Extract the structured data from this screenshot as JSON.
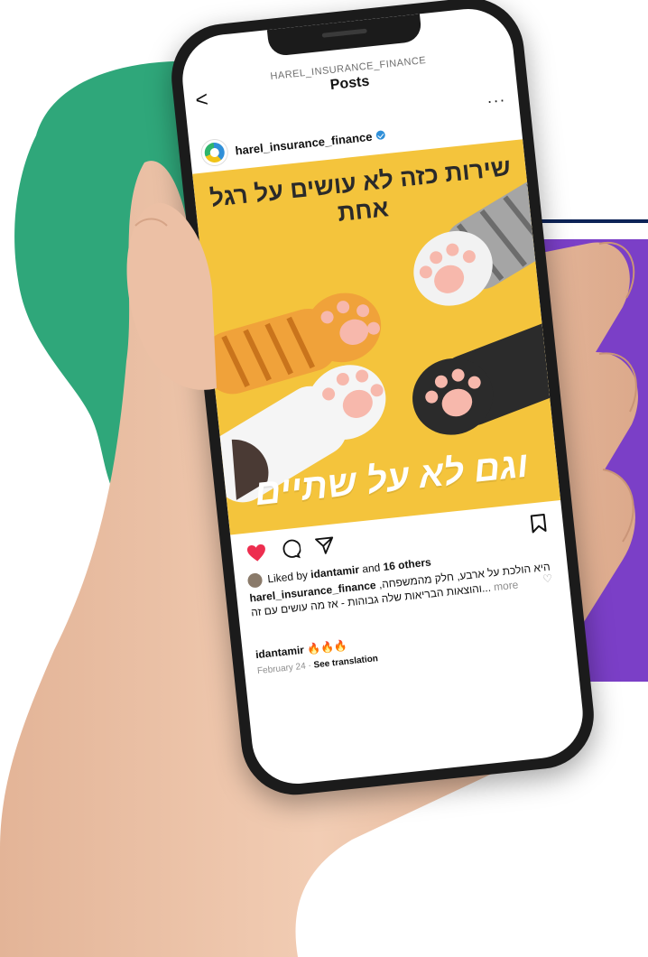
{
  "header": {
    "account": "HAREL_INSURANCE_FINANCE",
    "title": "Posts",
    "back_glyph": "<",
    "menu_glyph": "···"
  },
  "post": {
    "username": "harel_insurance_finance",
    "headline_line1": "שירות כזה לא עושים על רגל אחת",
    "headline_line2": "",
    "tagline": "וגם לא על שתיים"
  },
  "engagement": {
    "liked_prefix": "Liked by",
    "liked_user": "idantamir",
    "liked_mid": "and",
    "liked_count": "16 others"
  },
  "caption": {
    "username": "harel_insurance_finance",
    "text": "היא הולכת על ארבע, חלק מהמשפחה, והוצאות הבריאות שלה גבוהות - אז מה עושים עם זה...",
    "more": "more"
  },
  "comment": {
    "username": "idantamir",
    "emoji": "🔥🔥🔥"
  },
  "meta": {
    "date": "February 24",
    "separator": "·",
    "translate": "See translation"
  },
  "colors": {
    "post_bg": "#f4c43c",
    "green_blob": "#2fa77a",
    "purple_panel": "#7b3fc7",
    "like_red": "#ed2e4f"
  }
}
